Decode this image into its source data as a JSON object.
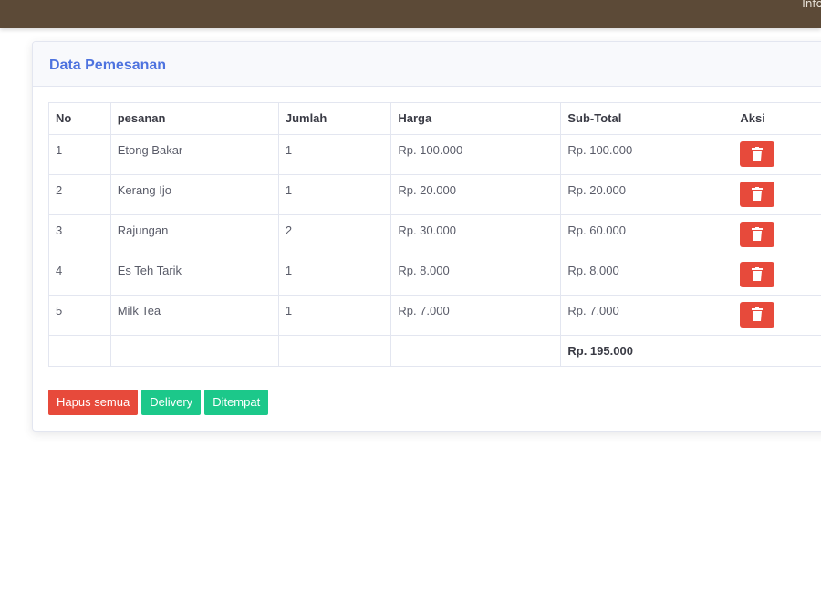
{
  "topbar": {
    "info_text": "Info"
  },
  "card": {
    "title": "Data Pemesanan"
  },
  "table": {
    "headers": [
      "No",
      "pesanan",
      "Jumlah",
      "Harga",
      "Sub-Total",
      "Aksi"
    ],
    "rows": [
      {
        "no": "1",
        "pesanan": "Etong Bakar",
        "jumlah": "1",
        "harga": "Rp. 100.000",
        "subtotal": "Rp. 100.000"
      },
      {
        "no": "2",
        "pesanan": "Kerang Ijo",
        "jumlah": "1",
        "harga": "Rp. 20.000",
        "subtotal": "Rp. 20.000"
      },
      {
        "no": "3",
        "pesanan": "Rajungan",
        "jumlah": "2",
        "harga": "Rp. 30.000",
        "subtotal": "Rp. 60.000"
      },
      {
        "no": "4",
        "pesanan": "Es Teh Tarik",
        "jumlah": "1",
        "harga": "Rp. 8.000",
        "subtotal": "Rp. 8.000"
      },
      {
        "no": "5",
        "pesanan": "Milk Tea",
        "jumlah": "1",
        "harga": "Rp. 7.000",
        "subtotal": "Rp. 7.000"
      }
    ],
    "total": "Rp. 195.000",
    "delete_icon": "trash-icon"
  },
  "buttons": {
    "hapus_semua": "Hapus semua",
    "delivery": "Delivery",
    "ditempat": "Ditempat"
  },
  "colors": {
    "topbar": "#5c4a37",
    "title": "#4e73df",
    "danger": "#e74a3b",
    "success": "#1cc88a"
  }
}
